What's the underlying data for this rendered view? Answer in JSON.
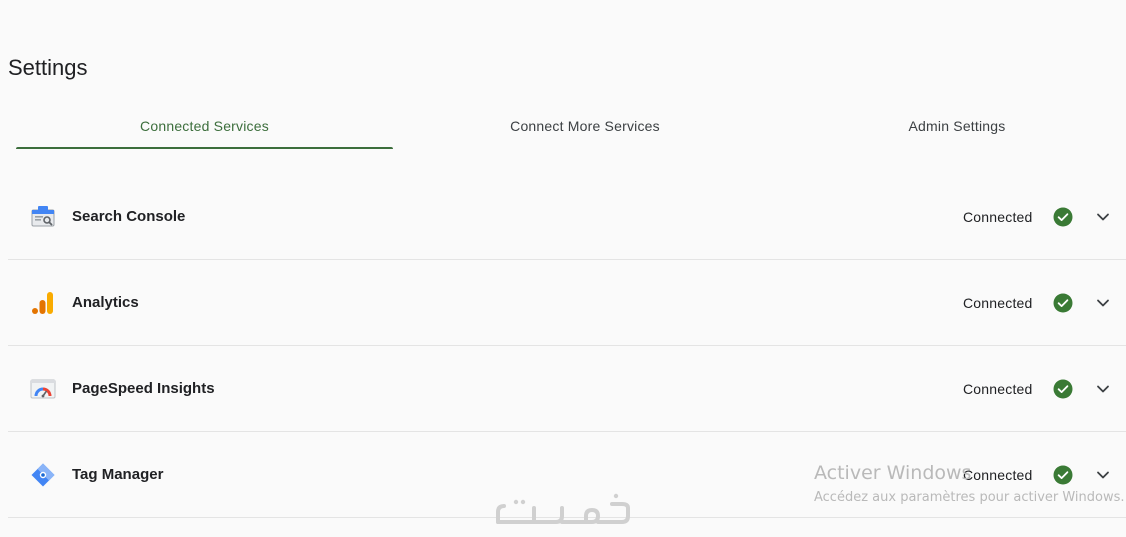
{
  "page": {
    "title": "Settings"
  },
  "tabs": [
    {
      "label": "Connected Services",
      "active": true
    },
    {
      "label": "Connect More Services",
      "active": false
    },
    {
      "label": "Admin Settings",
      "active": false
    }
  ],
  "services": [
    {
      "name": "Search Console",
      "status": "Connected",
      "icon": "search-console-icon"
    },
    {
      "name": "Analytics",
      "status": "Connected",
      "icon": "analytics-icon"
    },
    {
      "name": "PageSpeed Insights",
      "status": "Connected",
      "icon": "pagespeed-icon"
    },
    {
      "name": "Tag Manager",
      "status": "Connected",
      "icon": "tag-manager-icon"
    }
  ],
  "windows_watermark": {
    "title": "Activer Windows",
    "subtitle": "Accédez aux paramètres pour activer Windows."
  },
  "logo_watermark": {
    "text": "خمسات"
  },
  "colors": {
    "accent": "#3c6e3c",
    "check": "#3a7a35",
    "background": "#fafafa",
    "divider": "#e4e4e4"
  }
}
